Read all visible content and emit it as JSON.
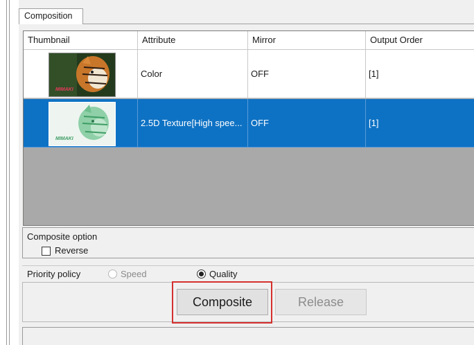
{
  "tab": {
    "label": "Composition"
  },
  "grid": {
    "columns": [
      "Thumbnail",
      "Attribute",
      "Mirror",
      "Output Order"
    ],
    "rows": [
      {
        "thumbnail": {
          "logo_text": "MIMAKI",
          "colors": [
            "#2c4a23",
            "#c8762a"
          ]
        },
        "attribute": "Color",
        "mirror": "OFF",
        "output_order": "[1]",
        "selected": false
      },
      {
        "thumbnail": {
          "logo_text": "MIMAKI",
          "colors": [
            "#e9f2ec",
            "#6fbf8e"
          ]
        },
        "attribute": "2.5D Texture[High spee...",
        "mirror": "OFF",
        "output_order": "[1]",
        "selected": true
      }
    ]
  },
  "composite_option": {
    "title": "Composite option",
    "reverse_label": "Reverse",
    "reverse_checked": false
  },
  "priority_policy": {
    "label": "Priority policy",
    "options": [
      "Speed",
      "Quality"
    ],
    "selected": "Quality"
  },
  "buttons": {
    "composite": "Composite",
    "release": "Release"
  },
  "colors": {
    "selection": "#0e72c4",
    "highlight": "#d4302e",
    "empty_area": "#a9a9aa"
  }
}
